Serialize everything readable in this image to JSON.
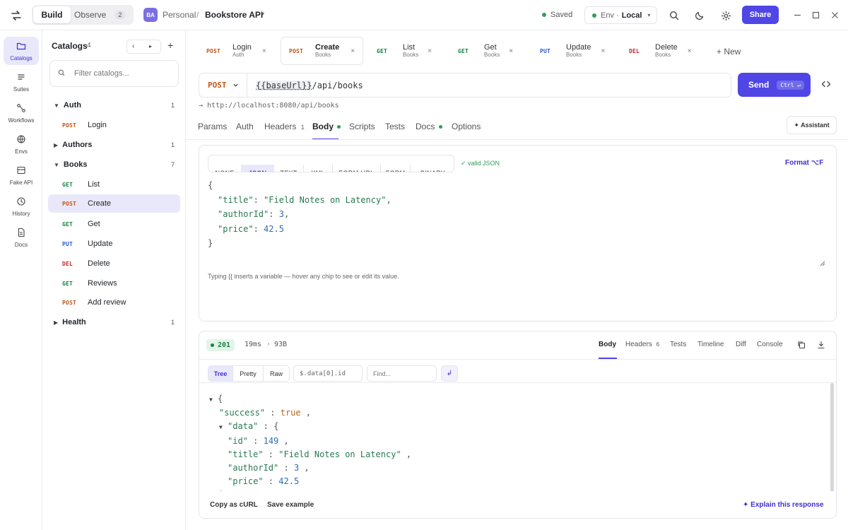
{
  "topbar": {
    "seg_build": "Build",
    "seg_observe": "Observe",
    "seg_observe_count": "2",
    "avatar": "BA",
    "workspace": "Personal",
    "separator": "/",
    "project": "Bookstore API",
    "saved": "Saved",
    "env_label": "Env ·",
    "env_value": "Local",
    "share": "Share"
  },
  "rail": [
    {
      "label": "Catalogs",
      "icon": "folder-icon"
    },
    {
      "label": "Suites",
      "icon": "list-icon"
    },
    {
      "label": "Workflows",
      "icon": "workflow-icon"
    },
    {
      "label": "Envs",
      "icon": "globe-icon"
    },
    {
      "label": "Fake API",
      "icon": "server-icon"
    },
    {
      "label": "History",
      "icon": "clock-icon"
    },
    {
      "label": "Docs",
      "icon": "doc-icon"
    }
  ],
  "sidebar": {
    "title": "Catalogs",
    "count": "4",
    "filter_placeholder": "Filter catalogs...",
    "groups": [
      {
        "name": "Auth",
        "count": "1"
      },
      {
        "name": "Authors",
        "count": "1"
      },
      {
        "name": "Books",
        "count": "7"
      },
      {
        "name": "Health",
        "count": "1"
      }
    ],
    "items": [
      {
        "method": "POST",
        "name": "Login"
      },
      {
        "method": "GET",
        "name": "List"
      },
      {
        "method": "POST",
        "name": "Create"
      },
      {
        "method": "GET",
        "name": "Get"
      },
      {
        "method": "PUT",
        "name": "Update"
      },
      {
        "method": "DEL",
        "name": "Delete"
      },
      {
        "method": "GET",
        "name": "Reviews"
      },
      {
        "method": "POST",
        "name": "Add review"
      }
    ]
  },
  "tabs": [
    {
      "method": "POST",
      "name": "Login",
      "catalog": "Auth"
    },
    {
      "method": "POST",
      "name": "Create",
      "catalog": "Books"
    },
    {
      "method": "GET",
      "name": "List",
      "catalog": "Books"
    },
    {
      "method": "GET",
      "name": "Get",
      "catalog": "Books"
    },
    {
      "method": "PUT",
      "name": "Update",
      "catalog": "Books"
    },
    {
      "method": "DEL",
      "name": "Delete",
      "catalog": "Books"
    }
  ],
  "tabs_new": "+ New",
  "request": {
    "method": "POST",
    "url_var": "{{baseUrl}}",
    "url_path": "/api/books",
    "send": "Send",
    "send_shortcut": "Ctrl ↵",
    "resolved": "→ http://localhost:8080/api/books",
    "tabs": [
      "Params",
      "Auth",
      "Headers",
      "Body",
      "Scripts",
      "Tests",
      "Docs",
      "Options"
    ],
    "headers_count": "1",
    "assistant": "✦ Assistant"
  },
  "body": {
    "formats": [
      "NONE",
      "JSON",
      "TEXT",
      "XML",
      "FORM-URL",
      "FORM",
      "BINARY"
    ],
    "valid": "✓ valid JSON",
    "format_btn": "Format ⌥F",
    "json": {
      "title": "Field Notes on Latency",
      "authorId": "3",
      "price": "42.5"
    },
    "hint": "Typing {{ inserts a variable — hover any chip to see or edit its value."
  },
  "response": {
    "status": "201",
    "time": "19ms",
    "dot": "·",
    "size": "93B",
    "tabs": [
      "Body",
      "Headers",
      "Tests",
      "Timeline",
      "Diff",
      "Console"
    ],
    "headers_count": "6",
    "views": [
      "Tree",
      "Pretty",
      "Raw"
    ],
    "path_placeholder": "$.data[0].id",
    "find_placeholder": "Find...",
    "tree": {
      "success": "true",
      "id": "149",
      "title": "Field Notes on Latency",
      "authorId": "3",
      "price": "42.5"
    },
    "copy_curl": "Copy as cURL",
    "save_example": "Save example",
    "explain": "✦ Explain this response"
  },
  "colors": {
    "accent": "#4f46e5",
    "get": "#1a7f45",
    "post": "#c2561a",
    "put": "#2f5bd3",
    "del": "#c0282d"
  }
}
